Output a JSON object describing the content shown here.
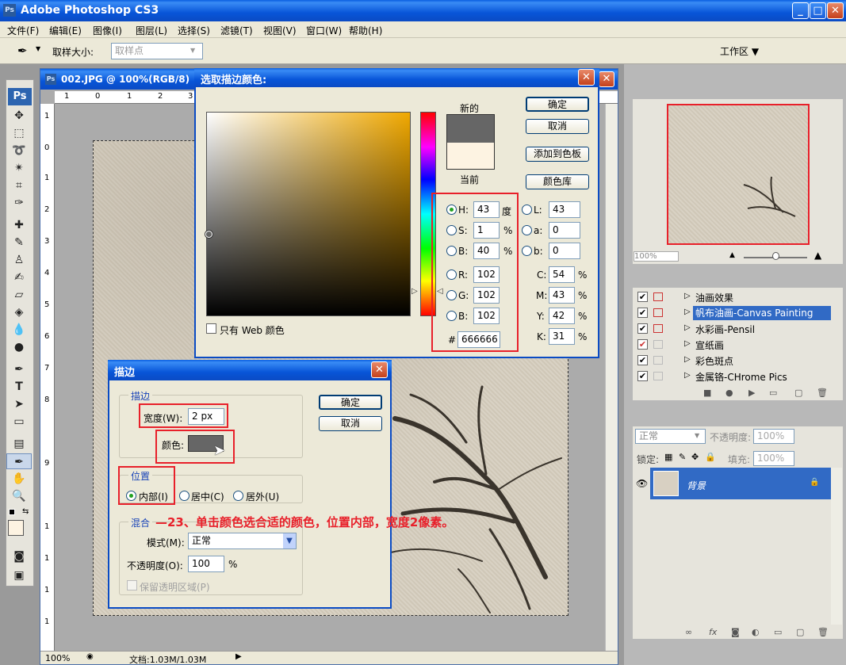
{
  "app": {
    "title": "Adobe Photoshop CS3",
    "ps_badge": "Ps",
    "min": "_",
    "max": "□",
    "close": "✕"
  },
  "menu": [
    "文件(F)",
    "编辑(E)",
    "图像(I)",
    "图层(L)",
    "选择(S)",
    "滤镜(T)",
    "视图(V)",
    "窗口(W)",
    "帮助(H)"
  ],
  "options": {
    "sample_size_label": "取样大小:",
    "sample_size_value": "取样点",
    "workspace": "工作区 ▼"
  },
  "doc": {
    "title": "002.JPG @ 100%(RGB/8)",
    "ruler_top": [
      "1",
      "0",
      "1",
      "2",
      "3"
    ],
    "ruler_left": [
      "1",
      "0",
      "1",
      "2",
      "3",
      "4",
      "5",
      "6",
      "7",
      "8",
      "9",
      "1",
      "1",
      "1",
      "1"
    ],
    "zoom": "100%",
    "docsize": "文档:1.03M/1.03M"
  },
  "picker": {
    "title": "选取描边颜色:",
    "new_label": "新的",
    "current_label": "当前",
    "ok": "确定",
    "cancel": "取消",
    "add_swatch": "添加到色板",
    "color_lib": "颜色库",
    "web_only": "只有 Web 颜色",
    "new_color": "#666666",
    "current_color": "#fdf3e2",
    "hue_color": "#f0a800",
    "H": {
      "label": "H:",
      "value": "43",
      "unit": "度"
    },
    "S": {
      "label": "S:",
      "value": "1",
      "unit": "%"
    },
    "Bv": {
      "label": "B:",
      "value": "40",
      "unit": "%"
    },
    "R": {
      "label": "R:",
      "value": "102"
    },
    "G": {
      "label": "G:",
      "value": "102"
    },
    "Bc": {
      "label": "B:",
      "value": "102"
    },
    "L": {
      "label": "L:",
      "value": "43"
    },
    "a": {
      "label": "a:",
      "value": "0"
    },
    "b": {
      "label": "b:",
      "value": "0"
    },
    "C": {
      "label": "C:",
      "value": "54",
      "unit": "%"
    },
    "M": {
      "label": "M:",
      "value": "43",
      "unit": "%"
    },
    "Y": {
      "label": "Y:",
      "value": "42",
      "unit": "%"
    },
    "K": {
      "label": "K:",
      "value": "31",
      "unit": "%"
    },
    "hash": "#",
    "hex": "666666"
  },
  "stroke": {
    "title": "描边",
    "group_stroke": "描边",
    "width_label": "宽度(W):",
    "width_value": "2 px",
    "color_label": "颜色:",
    "stroke_color": "#666666",
    "group_location": "位置",
    "inside": "内部(I)",
    "center": "居中(C)",
    "outside": "居外(U)",
    "group_blend": "混合",
    "mode_label": "模式(M):",
    "mode_value": "正常",
    "opacity_label": "不透明度(O):",
    "opacity_value": "100",
    "opacity_unit": "%",
    "preserve": "保留透明区域(P)",
    "ok": "确定",
    "cancel": "取消"
  },
  "annotation": "—23、单击颜色选合适的颜色，位置内部，宽度2像素。",
  "navigator": {
    "zoom": "100%"
  },
  "actions": [
    "油画效果",
    "帆布油画-Canvas Painting",
    "水彩画-Pensil",
    "宣纸画",
    "彩色斑点",
    "金属铬-CHrome Pics"
  ],
  "layers": {
    "mode": "正常",
    "opacity_label": "不透明度:",
    "opacity": "100%",
    "lock_label": "锁定:",
    "fill_label": "填充:",
    "fill": "100%",
    "layer_name": "背景"
  }
}
